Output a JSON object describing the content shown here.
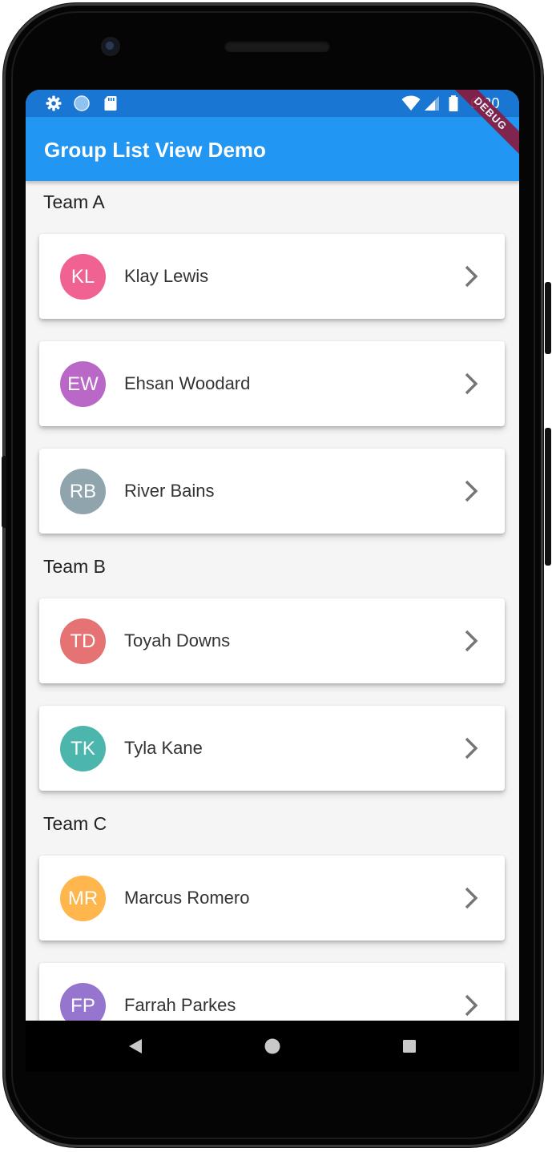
{
  "device": {
    "frame_color": "#050505"
  },
  "status_bar": {
    "time": "6:20",
    "background": "#1976d2",
    "left_icons": [
      "gear-icon",
      "circle-icon",
      "sd-card-icon"
    ],
    "right_icons": [
      "wifi-icon",
      "signal-icon",
      "battery-icon"
    ]
  },
  "app_bar": {
    "title": "Group List View Demo",
    "background": "#2196f3"
  },
  "debug_banner": {
    "label": "DEBUG",
    "color": "#8b1a3c"
  },
  "groups": [
    {
      "title": "Team A",
      "members": [
        {
          "initials": "KL",
          "name": "Klay Lewis",
          "color": "#f06292"
        },
        {
          "initials": "EW",
          "name": "Ehsan Woodard",
          "color": "#ba68c8"
        },
        {
          "initials": "RB",
          "name": "River Bains",
          "color": "#90a4ae"
        }
      ]
    },
    {
      "title": "Team B",
      "members": [
        {
          "initials": "TD",
          "name": "Toyah Downs",
          "color": "#e57373"
        },
        {
          "initials": "TK",
          "name": "Tyla Kane",
          "color": "#4db6ac"
        }
      ]
    },
    {
      "title": "Team C",
      "members": [
        {
          "initials": "MR",
          "name": "Marcus Romero",
          "color": "#ffb74d"
        },
        {
          "initials": "FP",
          "name": "Farrah Parkes",
          "color": "#9575cd"
        }
      ]
    }
  ],
  "nav_bar": {
    "buttons": [
      "back-icon",
      "home-icon",
      "recents-icon"
    ]
  }
}
